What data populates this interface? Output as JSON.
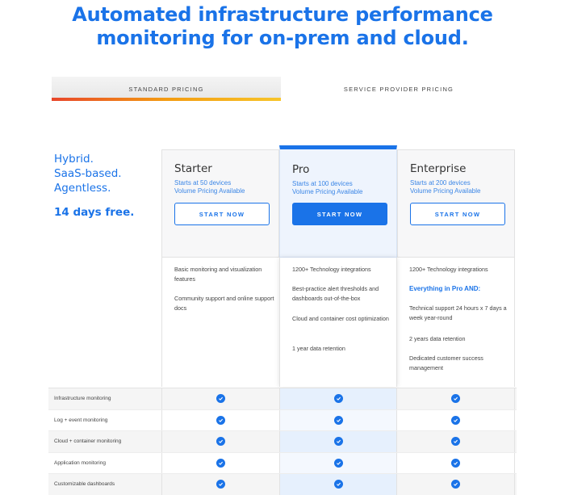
{
  "headline": {
    "line1": "Automated infrastructure performance",
    "line2": "monitoring for on-prem and cloud."
  },
  "tabs": {
    "standard": "STANDARD PRICING",
    "provider": "SERVICE PROVIDER PRICING",
    "active": "standard"
  },
  "tagline": {
    "line1": "Hybrid.",
    "line2": "SaaS-based.",
    "line3": "Agentless.",
    "free": "14 days free."
  },
  "plans": [
    {
      "name": "Starter",
      "sub1": "Starts at 50 devices",
      "sub2": "Volume Pricing Available",
      "button": "START NOW",
      "features": [
        "Basic monitoring and visualization features",
        "Community support and online support docs"
      ]
    },
    {
      "name": "Pro",
      "sub1": "Starts at 100 devices",
      "sub2": "Volume Pricing Available",
      "button": "START NOW",
      "features": [
        "1200+ Technology integrations",
        "Best-practice alert thresholds and dashboards out-of-the-box",
        "Cloud and container cost optimization",
        "1 year data retention"
      ]
    },
    {
      "name": "Enterprise",
      "sub1": "Starts at 200 devices",
      "sub2": "Volume Pricing Available",
      "button": "START NOW",
      "features": [
        "1200+ Technology integrations",
        "Everything in Pro AND:",
        "Technical support 24 hours x 7 days a week year-round",
        "2 years data retention",
        "Dedicated customer success management"
      ]
    }
  ],
  "comparison_rows": [
    "Infrastructure monitoring",
    "Log + event monitoring",
    "Cloud + container monitoring",
    "Application monitoring",
    "Customizable dashboards"
  ],
  "icons": {
    "check": "check-circle-icon"
  },
  "colors": {
    "accent": "#1a73e8",
    "tab_bar_start": "#e8462b",
    "tab_bar_end": "#f7c52b"
  }
}
